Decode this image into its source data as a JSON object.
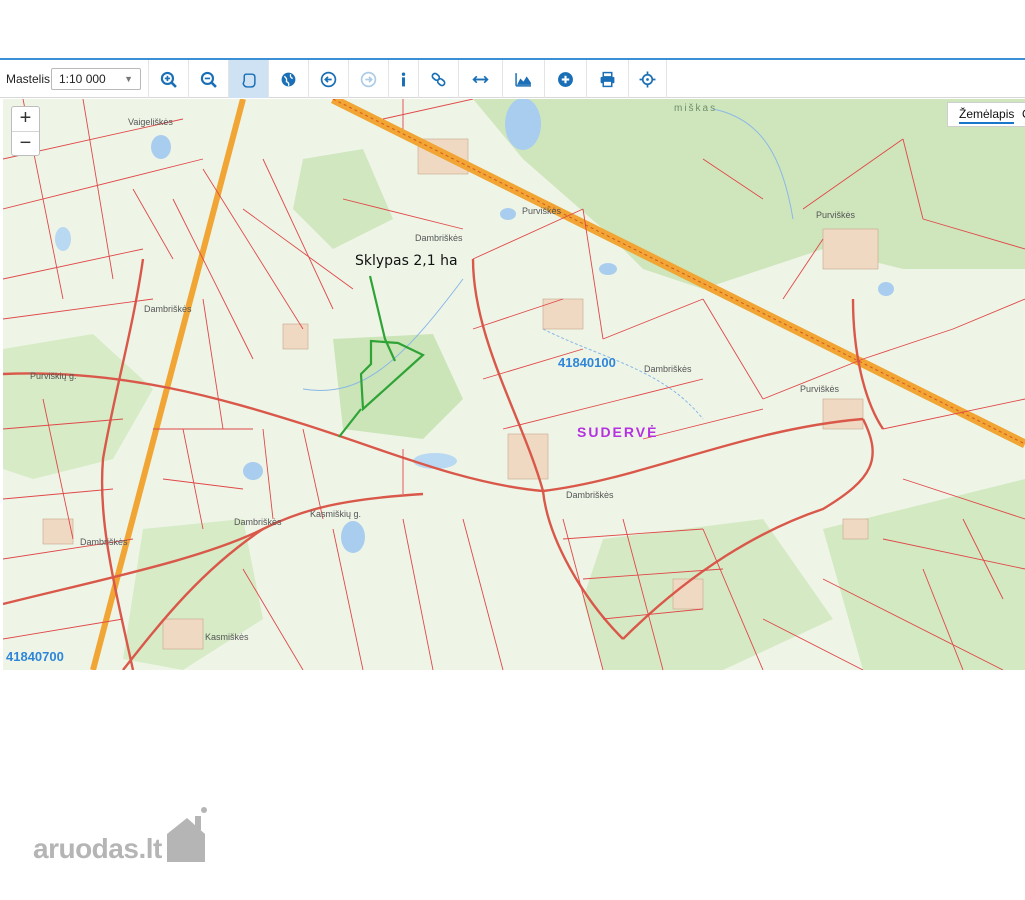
{
  "toolbar": {
    "scale_label": "Mastelis:",
    "scale_value": "1:10 000",
    "buttons": [
      {
        "icon": "zoom-in-icon",
        "active": false,
        "disabled": false
      },
      {
        "icon": "zoom-out-icon",
        "active": false,
        "disabled": false
      },
      {
        "icon": "hand-pan-icon",
        "active": true,
        "disabled": false
      },
      {
        "icon": "globe-icon",
        "active": false,
        "disabled": false
      },
      {
        "icon": "back-arrow-icon",
        "active": false,
        "disabled": false
      },
      {
        "icon": "forward-arrow-icon",
        "active": false,
        "disabled": true
      },
      {
        "icon": "info-icon",
        "active": false,
        "disabled": false
      },
      {
        "icon": "link-icon",
        "active": false,
        "disabled": false
      },
      {
        "icon": "measure-distance-icon",
        "active": false,
        "disabled": false
      },
      {
        "icon": "profile-chart-icon",
        "active": false,
        "disabled": false
      },
      {
        "icon": "add-icon",
        "active": false,
        "disabled": false
      },
      {
        "icon": "print-icon",
        "active": false,
        "disabled": false
      },
      {
        "icon": "locate-icon",
        "active": false,
        "disabled": false
      }
    ]
  },
  "map": {
    "zoom_in": "+",
    "zoom_out": "−",
    "layer_tabs": [
      "Žemėlapis",
      "O"
    ],
    "annotation": "Sklypas 2,1 ha",
    "district": "SUDERVĖ",
    "cadastral_codes": [
      "41840100",
      "41840700"
    ],
    "place_labels": [
      "Vaigeliškės",
      "Purviškės",
      "Dambriškės",
      "Dambriškės",
      "Purviškės",
      "Dambriškės",
      "Dambriškės",
      "Purviškės",
      "Dambriškės",
      "Dambriškės",
      "Kasmiškės",
      "Purviškių g.",
      "Kasmiškių g.",
      "miškas"
    ],
    "colors": {
      "parcel_line": "#d83a3a",
      "road_main": "#f1a534",
      "plot_outline": "#2fa336",
      "forest": "#cfe6bd",
      "water": "#a9cdee",
      "code_text": "#2f86d9",
      "district_text": "#b531e0"
    }
  },
  "watermark": {
    "brand": "aruodas",
    "suffix": ".lt"
  }
}
